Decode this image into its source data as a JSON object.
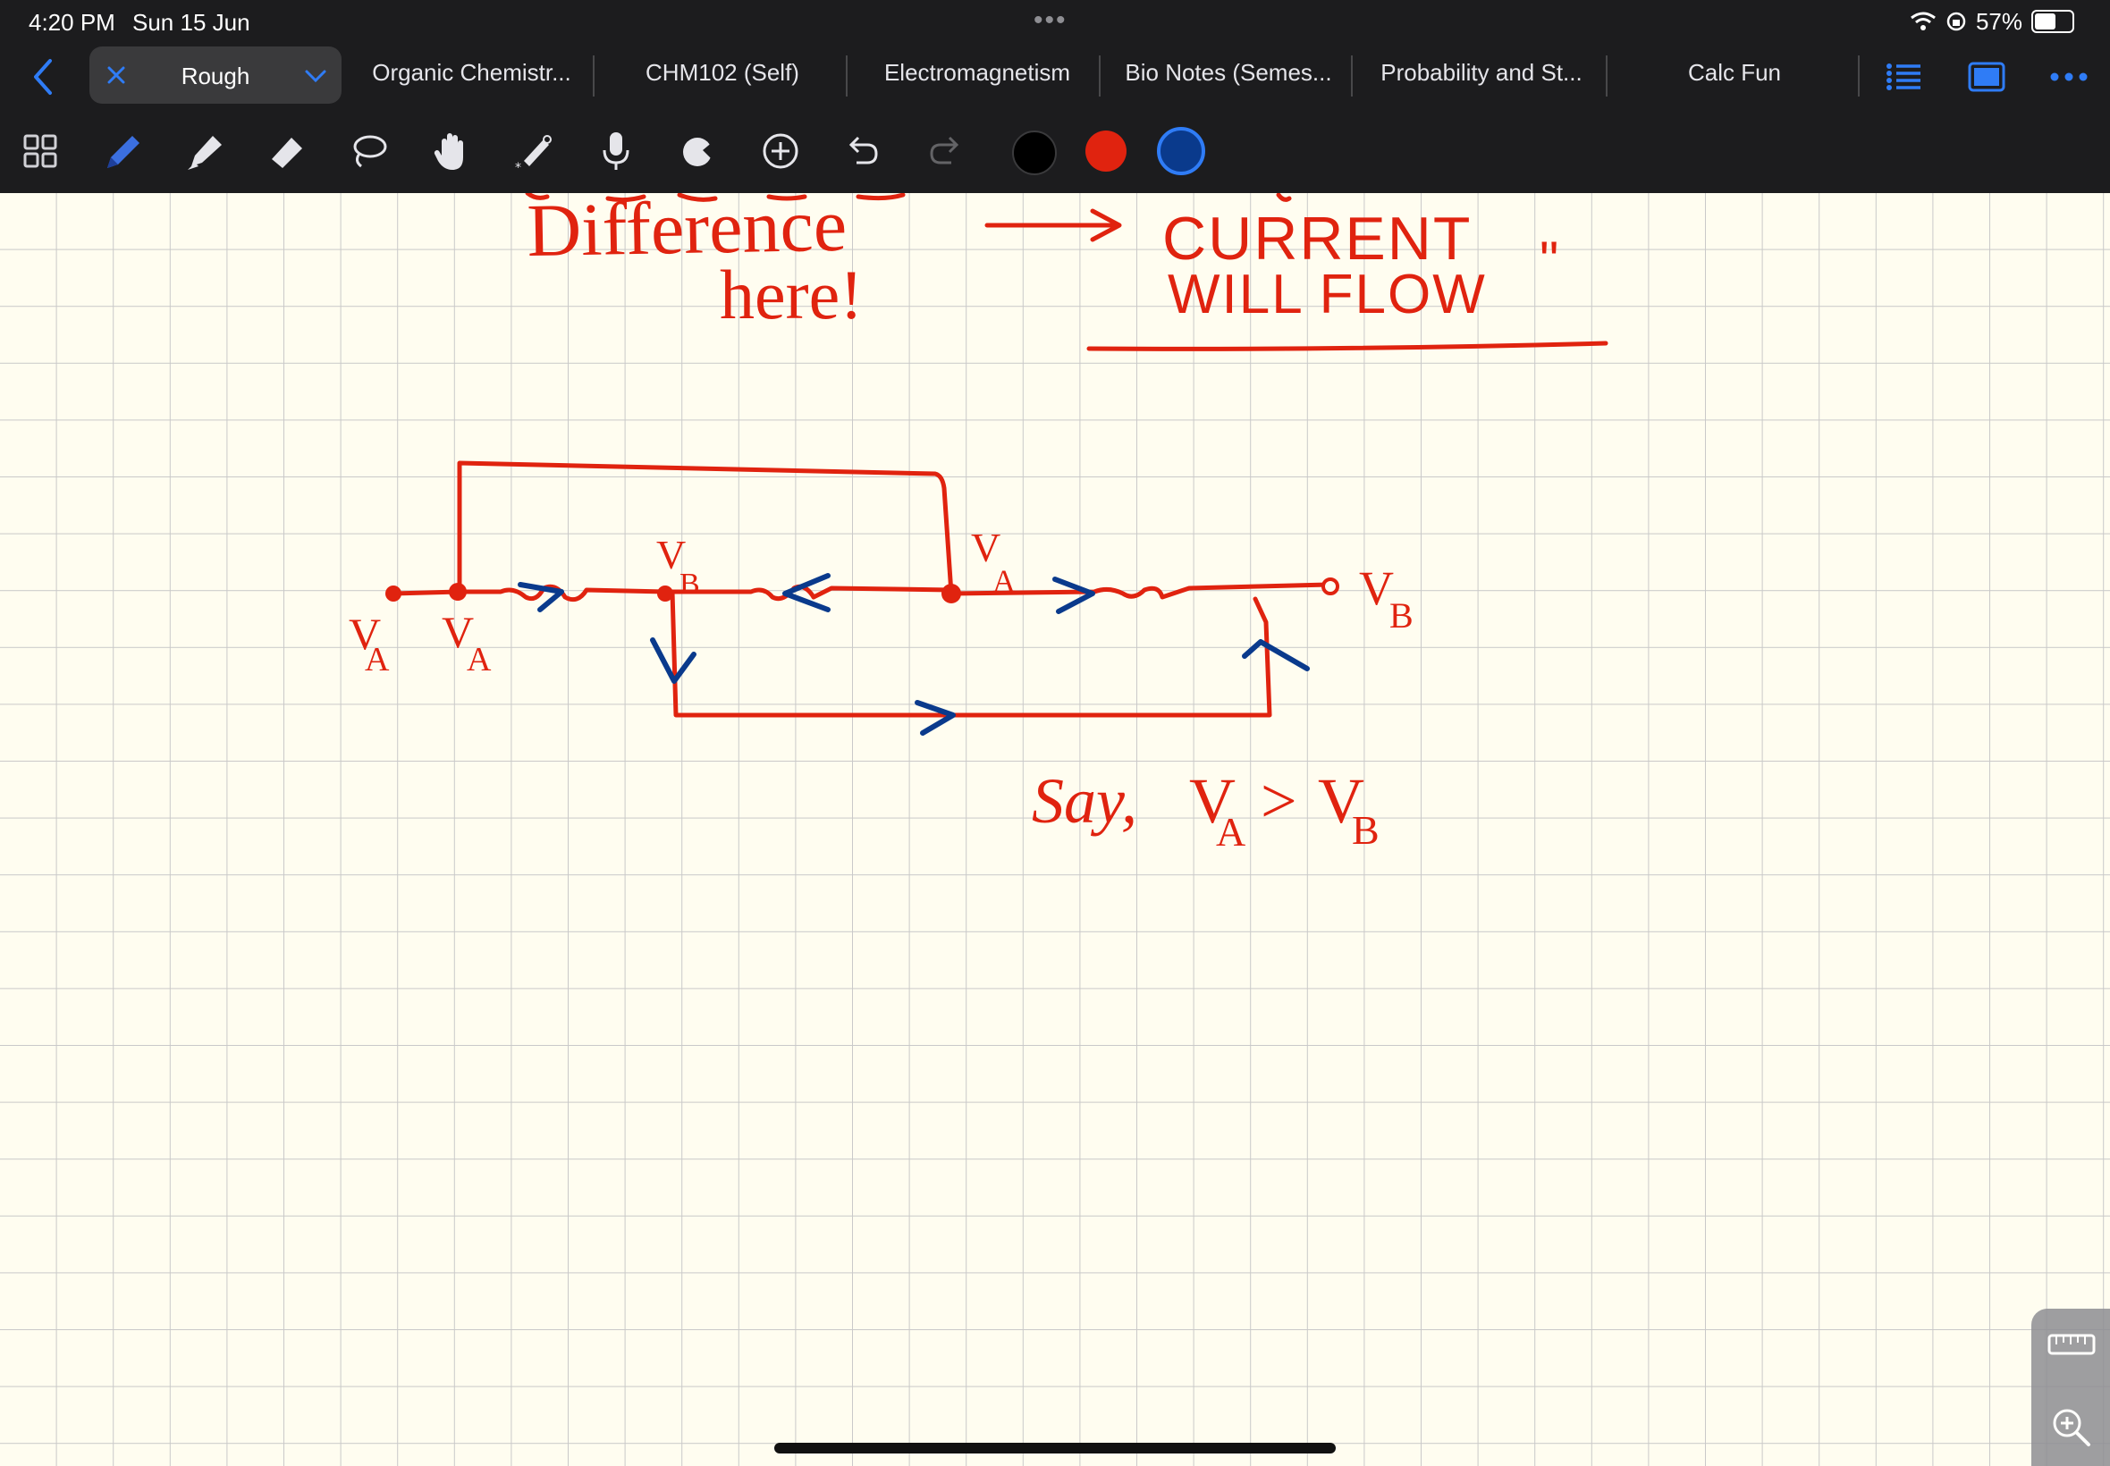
{
  "status": {
    "time": "4:20 PM",
    "date": "Sun 15 Jun",
    "battery_pct_text": "57%",
    "battery_level": 0.57
  },
  "tabs": {
    "active": "Rough",
    "items": [
      "Organic Chemistr...",
      "CHM102 (Self)",
      "Electromagnetism",
      "Bio Notes (Semes...",
      "Probability and St...",
      "Calc Fun"
    ]
  },
  "toolbar": {
    "tools": [
      "grid-icon",
      "pen-icon",
      "highlighter-icon",
      "eraser-icon",
      "lasso-icon",
      "hand-icon",
      "laser-pointer-icon",
      "microphone-icon",
      "shapes-icon",
      "add-icon",
      "undo-icon",
      "redo-icon"
    ],
    "colors": [
      "#000000",
      "#e0230f",
      "#0a3a8c"
    ],
    "selected_color": "#0a3a8c"
  },
  "colors": {
    "accent": "#2f7cf6",
    "ink_red": "#e0230f",
    "ink_blue": "#0a3a8c",
    "grid": "#c9c9c9"
  },
  "notes": {
    "line1": "Difference",
    "line2": "here!",
    "current_line1": "CURRENT",
    "current_line2": "WILL FLOW",
    "quote": "\"",
    "label_va": "V",
    "label_vb": "V",
    "sub_a": "A",
    "sub_b": "B",
    "say": "Say,",
    "gt": ">"
  }
}
